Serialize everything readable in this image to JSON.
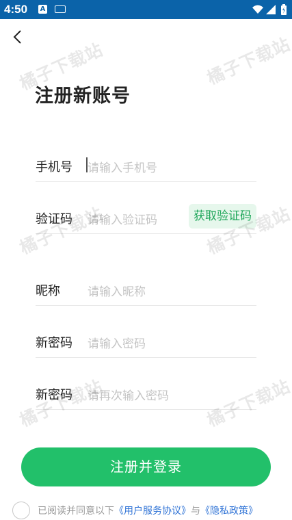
{
  "status_bar": {
    "time": "4:50",
    "notif_letter": "A"
  },
  "header": {
    "title": "注册新账号"
  },
  "form": {
    "phone": {
      "label": "手机号",
      "placeholder": "请输入手机号"
    },
    "code": {
      "label": "验证码",
      "placeholder": "请输入验证码",
      "send_button": "获取验证码"
    },
    "nickname": {
      "label": "昵称",
      "placeholder": "请输入昵称"
    },
    "password": {
      "label": "新密码",
      "placeholder": "请输入密码"
    },
    "password_confirm": {
      "label": "新密码",
      "placeholder": "请再次输入密码"
    }
  },
  "submit": {
    "label": "注册并登录"
  },
  "agreement": {
    "prefix": "已阅读并同意以下",
    "terms": "《用户服务协议》",
    "joiner": "与",
    "privacy": "《隐私政策》"
  },
  "watermark": {
    "text": "橘子下载站"
  },
  "colors": {
    "status_bar": "#0b63a9",
    "accent": "#22c06a",
    "link": "#2f73d6",
    "code_button_bg": "#e6f7ec"
  }
}
